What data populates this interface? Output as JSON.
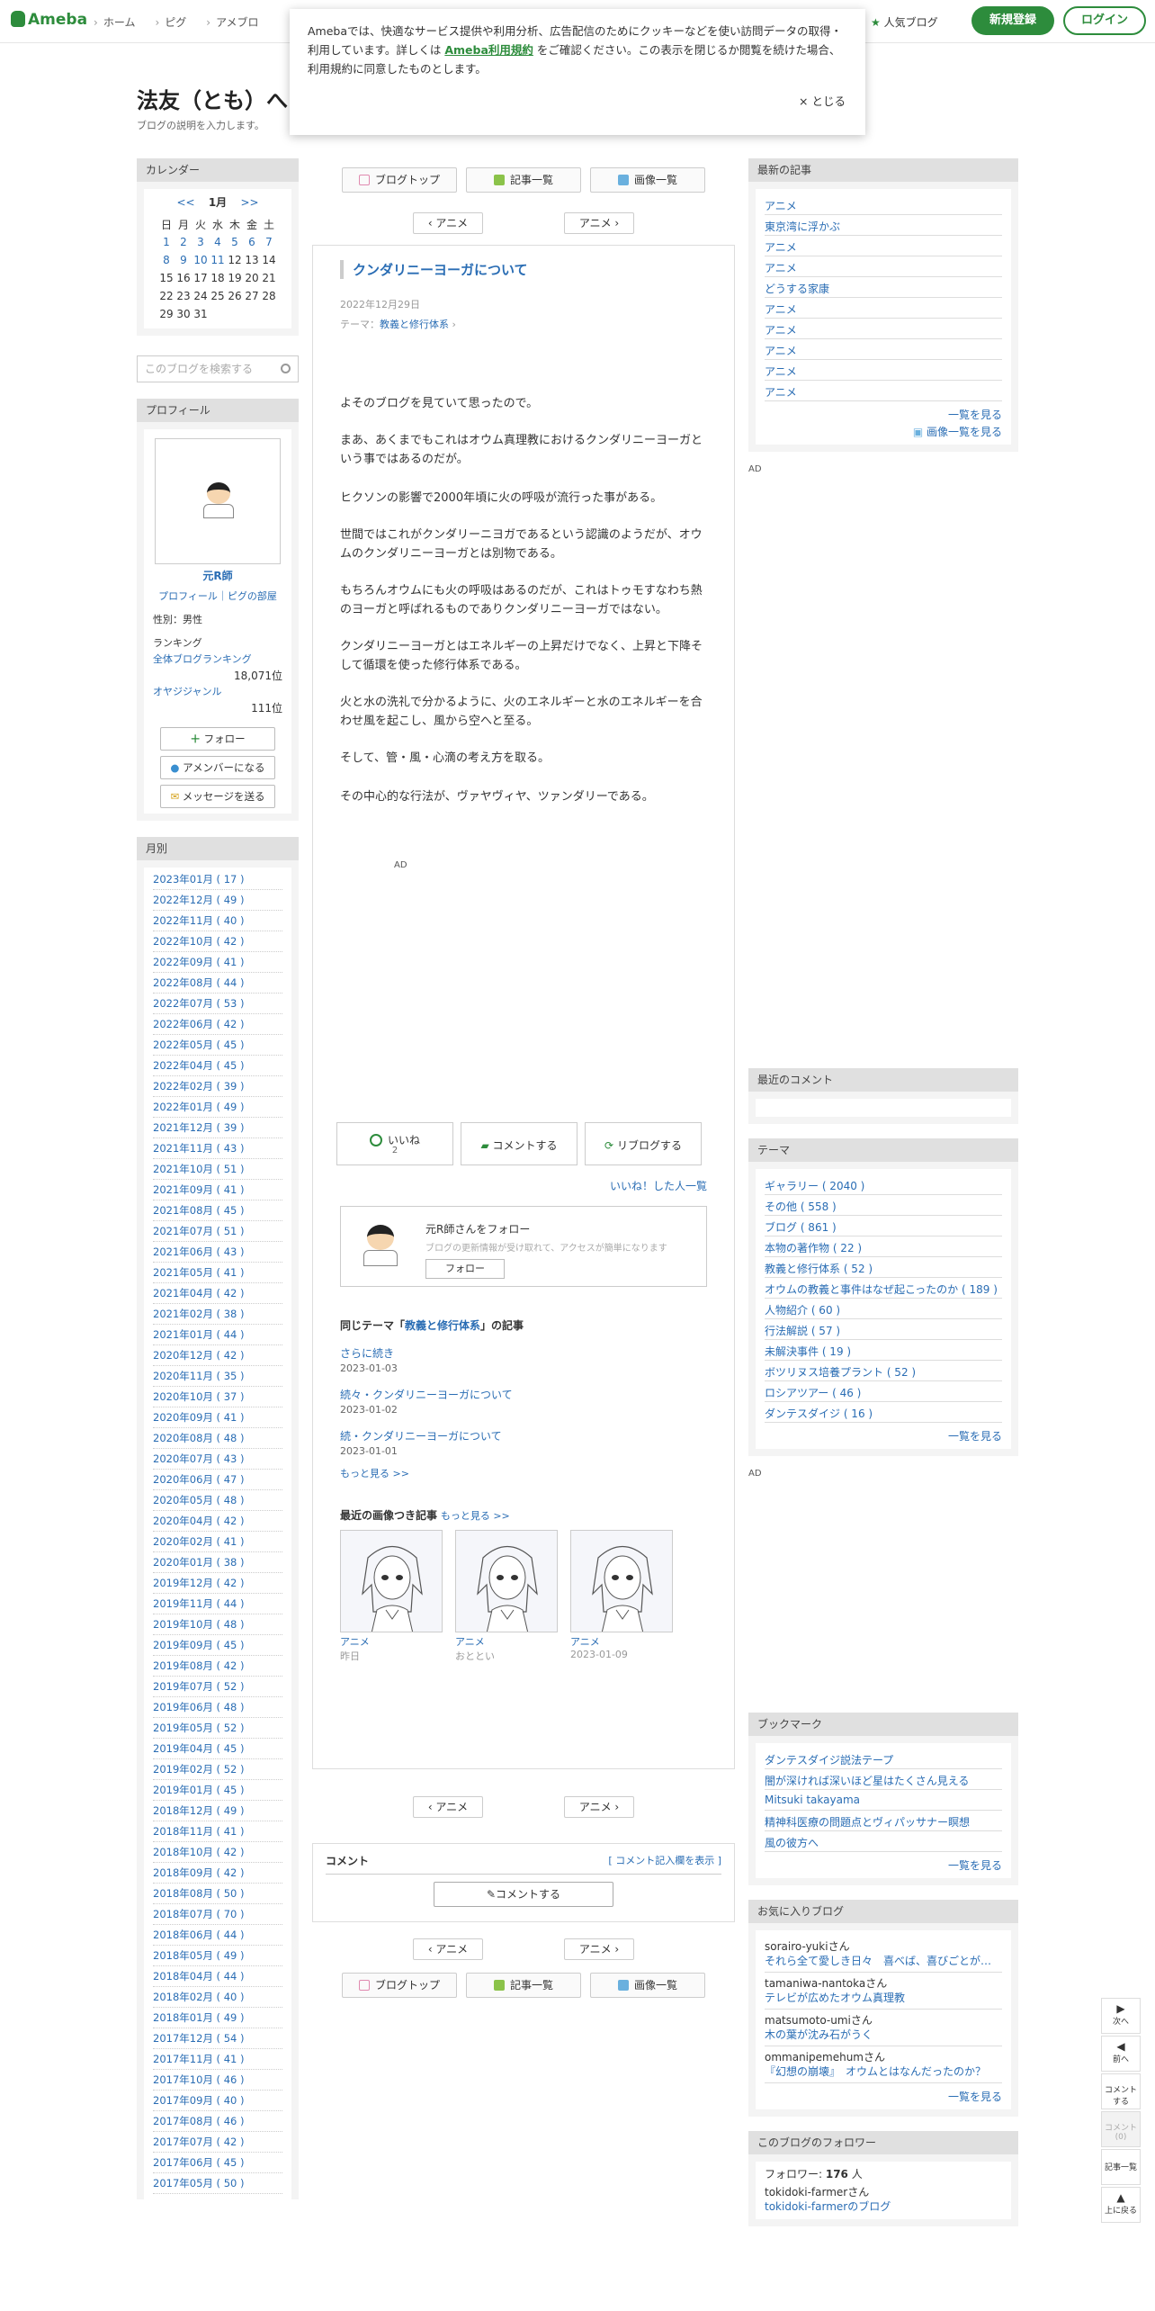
{
  "header": {
    "logo": "Ameba",
    "nav": [
      "ホーム",
      "ピグ",
      "アメブロ"
    ],
    "popular": "人気ブログ",
    "register": "新規登録",
    "login": "ログイン"
  },
  "cookie": {
    "text1": "Amebaでは、快適なサービス提供や利用分析、広告配信のためにクッキーなどを使い訪問データの取得・利用しています。詳しくは ",
    "link": "Ameba利用規約",
    "text2": " をご確認ください。この表示を閉じるか閲覧を続けた場合、利用規約に同意したものとします。",
    "close": "× とじる"
  },
  "blog": {
    "title": "法友（とも）へ",
    "desc": "ブログの説明を入力します。"
  },
  "calendar": {
    "header": "カレンダー",
    "prev": "<<",
    "month": "1月",
    "next": ">>",
    "weekdays": [
      "日",
      "月",
      "火",
      "水",
      "木",
      "金",
      "土"
    ],
    "rows": [
      [
        "1",
        "2",
        "3",
        "4",
        "5",
        "6",
        "7"
      ],
      [
        "8",
        "9",
        "10",
        "11",
        "12",
        "13",
        "14"
      ],
      [
        "15",
        "16",
        "17",
        "18",
        "19",
        "20",
        "21"
      ],
      [
        "22",
        "23",
        "24",
        "25",
        "26",
        "27",
        "28"
      ],
      [
        "29",
        "30",
        "31",
        "",
        "",
        "",
        ""
      ]
    ],
    "linked": [
      "1",
      "2",
      "3",
      "4",
      "5",
      "6",
      "7",
      "8",
      "9",
      "10",
      "11"
    ]
  },
  "search": {
    "placeholder": "このブログを検索する"
  },
  "profile": {
    "header": "プロフィール",
    "name": "元R師",
    "links": "プロフィール｜ピグの部屋",
    "gender": "性別：男性",
    "ranking": "ランキング",
    "overall": "全体ブログランキング",
    "overall_rank": "18,071位",
    "genre": "オヤジジャンル",
    "genre_rank": "111位",
    "follow": "フォロー",
    "member": "アメンバーになる",
    "message": "メッセージを送る"
  },
  "monthly": {
    "header": "月別",
    "items": [
      "2023年01月 ( 17 )",
      "2022年12月 ( 49 )",
      "2022年11月 ( 40 )",
      "2022年10月 ( 42 )",
      "2022年09月 ( 41 )",
      "2022年08月 ( 44 )",
      "2022年07月 ( 53 )",
      "2022年06月 ( 42 )",
      "2022年05月 ( 45 )",
      "2022年04月 ( 45 )",
      "2022年02月 ( 39 )",
      "2022年01月 ( 49 )",
      "2021年12月 ( 39 )",
      "2021年11月 ( 43 )",
      "2021年10月 ( 51 )",
      "2021年09月 ( 41 )",
      "2021年08月 ( 45 )",
      "2021年07月 ( 51 )",
      "2021年06月 ( 43 )",
      "2021年05月 ( 41 )",
      "2021年04月 ( 42 )",
      "2021年02月 ( 38 )",
      "2021年01月 ( 44 )",
      "2020年12月 ( 42 )",
      "2020年11月 ( 35 )",
      "2020年10月 ( 37 )",
      "2020年09月 ( 41 )",
      "2020年08月 ( 48 )",
      "2020年07月 ( 43 )",
      "2020年06月 ( 47 )",
      "2020年05月 ( 48 )",
      "2020年04月 ( 42 )",
      "2020年02月 ( 41 )",
      "2020年01月 ( 38 )",
      "2019年12月 ( 42 )",
      "2019年11月 ( 44 )",
      "2019年10月 ( 48 )",
      "2019年09月 ( 45 )",
      "2019年08月 ( 42 )",
      "2019年07月 ( 52 )",
      "2019年06月 ( 48 )",
      "2019年05月 ( 52 )",
      "2019年04月 ( 45 )",
      "2019年02月 ( 52 )",
      "2019年01月 ( 45 )",
      "2018年12月 ( 49 )",
      "2018年11月 ( 41 )",
      "2018年10月 ( 42 )",
      "2018年09月 ( 42 )",
      "2018年08月 ( 50 )",
      "2018年07月 ( 70 )",
      "2018年06月 ( 44 )",
      "2018年05月 ( 49 )",
      "2018年04月 ( 44 )",
      "2018年02月 ( 40 )",
      "2018年01月 ( 49 )",
      "2017年12月 ( 54 )",
      "2017年11月 ( 41 )",
      "2017年10月 ( 46 )",
      "2017年09月 ( 40 )",
      "2017年08月 ( 46 )",
      "2017年07月 ( 42 )",
      "2017年06月 ( 45 )",
      "2017年05月 ( 50 )"
    ]
  },
  "tabs": {
    "top": "ブログトップ",
    "list": "記事一覧",
    "images": "画像一覧"
  },
  "pager": {
    "prev": "‹ アニメ",
    "next": "アニメ ›"
  },
  "article": {
    "title": "クンダリニーヨーガについて",
    "date": "2022年12月29日",
    "theme_label": "テーマ：",
    "theme": "教義と修行体系",
    "paragraphs": [
      "よそのブログを見ていて思ったので。",
      "まあ、あくまでもこれはオウム真理教におけるクンダリニーヨーガという事ではあるのだが。",
      "ヒクソンの影響で2000年頃に火の呼吸が流行った事がある。",
      "世間ではこれがクンダリーニヨガであるという認識のようだが、オウムのクンダリニーヨーガとは別物である。",
      "もちろんオウムにも火の呼吸はあるのだが、これはトゥモすなわち熱のヨーガと呼ばれるものでありクンダリニーヨーガではない。",
      "クンダリニーヨーガとはエネルギーの上昇だけでなく、上昇と下降そして循環を使った修行体系である。",
      "火と水の洗礼で分かるように、火のエネルギーと水のエネルギーを合わせ風を起こし、風から空へと至る。",
      "そして、管・風・心滴の考え方を取る。",
      "その中心的な行法が、ヴァヤヴィヤ、ツァンダリーである。"
    ],
    "ad": "AD",
    "like": "いいね",
    "like_count": "2",
    "comment": "コメントする",
    "reblog": "リブログする",
    "liked_link": "いいね！した人一覧"
  },
  "followbox": {
    "name": "元R師さんをフォロー",
    "sub": "ブログの更新情報が受け取れて、アクセスが簡単になります",
    "btn": "フォロー"
  },
  "related": {
    "head_pre": "同じテーマ「",
    "theme": "教義と修行体系",
    "head_post": "」の記事",
    "items": [
      {
        "t": "さらに続き",
        "d": "2023-01-03"
      },
      {
        "t": "続々・クンダリニーヨーガについて",
        "d": "2023-01-02"
      },
      {
        "t": "続・クンダリニーヨーガについて",
        "d": "2023-01-01"
      }
    ],
    "more": "もっと見る >>"
  },
  "images": {
    "head": "最近の画像つき記事",
    "more": "もっと見る >>",
    "items": [
      {
        "t": "アニメ",
        "d": "昨日"
      },
      {
        "t": "アニメ",
        "d": "おととい"
      },
      {
        "t": "アニメ",
        "d": "2023-01-09"
      }
    ]
  },
  "comments": {
    "head": "コメント",
    "toggle": "[ コメント記入欄を表示 ]",
    "btn": "コメントする"
  },
  "recent": {
    "header": "最新の記事",
    "items": [
      "アニメ",
      "東京湾に浮かぶ",
      "アニメ",
      "アニメ",
      "どうする家康",
      "アニメ",
      "アニメ",
      "アニメ",
      "アニメ",
      "アニメ"
    ],
    "more": "一覧を見る",
    "imgmore": "画像一覧を見る"
  },
  "ad": "AD",
  "recentcomments": {
    "header": "最近のコメント"
  },
  "themes": {
    "header": "テーマ",
    "items": [
      "ギャラリー ( 2040 )",
      "その他 ( 558 )",
      "ブログ ( 861 )",
      "本物の著作物 ( 22 )",
      "教義と修行体系 ( 52 )",
      "オウムの教義と事件はなぜ起こったのか ( 189 )",
      "人物紹介 ( 60 )",
      "行法解説 ( 57 )",
      "未解決事件 ( 19 )",
      "ボツリヌス培養プラント ( 52 )",
      "ロシアツアー ( 46 )",
      "ダンテスダイジ ( 16 )"
    ],
    "more": "一覧を見る"
  },
  "bookmarks": {
    "header": "ブックマーク",
    "items": [
      "ダンテスダイジ説法テープ",
      "闇が深ければ深いほど星はたくさん見える",
      "Mitsuki takayama",
      "精神科医療の問題点とヴィパッサナー瞑想",
      "風の彼方へ"
    ],
    "more": "一覧を見る"
  },
  "favs": {
    "header": "お気に入りブログ",
    "items": [
      {
        "u": "sorairo-yuki",
        "s": "さん",
        "t": "それら全て愛しき日々　喜べば、喜びごとが…"
      },
      {
        "u": "tamaniwa-nantoka",
        "s": "さん",
        "t": "テレビが広めたオウム真理教"
      },
      {
        "u": "matsumoto-umi",
        "s": "さん",
        "t": "木の葉が沈み石がうく"
      },
      {
        "u": "ommanipemehum",
        "s": "さん",
        "t": "『幻想の崩壊』　オウムとはなんだったのか？"
      }
    ],
    "more": "一覧を見る"
  },
  "followers": {
    "header": "このブログのフォロワー",
    "label": "フォロワー: ",
    "count": "176",
    "unit": " 人",
    "user": "tokidoki-farmer",
    "suffix": "さん",
    "blog": "tokidoki-farmerのブログ"
  },
  "floating": {
    "next": "次へ",
    "prev": "前へ",
    "comment": "コメントする",
    "comment_count": "コメント(0)",
    "list": "記事一覧",
    "top": "上に戻る"
  }
}
